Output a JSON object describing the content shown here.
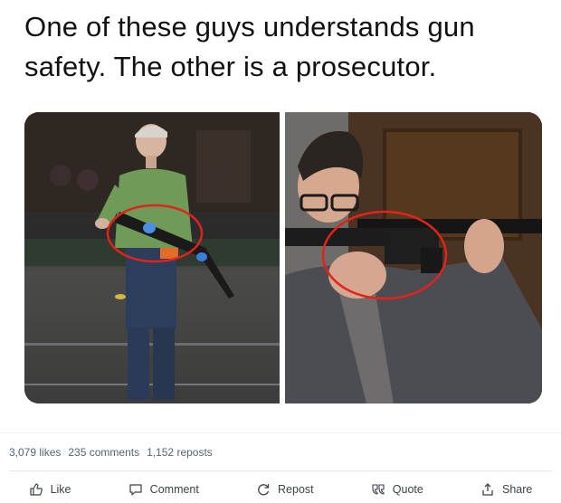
{
  "post": {
    "text": "One of these guys understands gun safety. The other is a prosecutor."
  },
  "stats": {
    "likes": "3,079 likes",
    "comments": "235 comments",
    "reposts": "1,152 reposts"
  },
  "actions": [
    {
      "label": "Like",
      "icon": "thumbs-up-icon"
    },
    {
      "label": "Comment",
      "icon": "comment-icon"
    },
    {
      "label": "Repost",
      "icon": "repost-icon"
    },
    {
      "label": "Quote",
      "icon": "quote-icon"
    },
    {
      "label": "Share",
      "icon": "share-icon"
    }
  ],
  "colors": {
    "annotation_circle": "#e0241b",
    "text_muted": "#536471"
  }
}
